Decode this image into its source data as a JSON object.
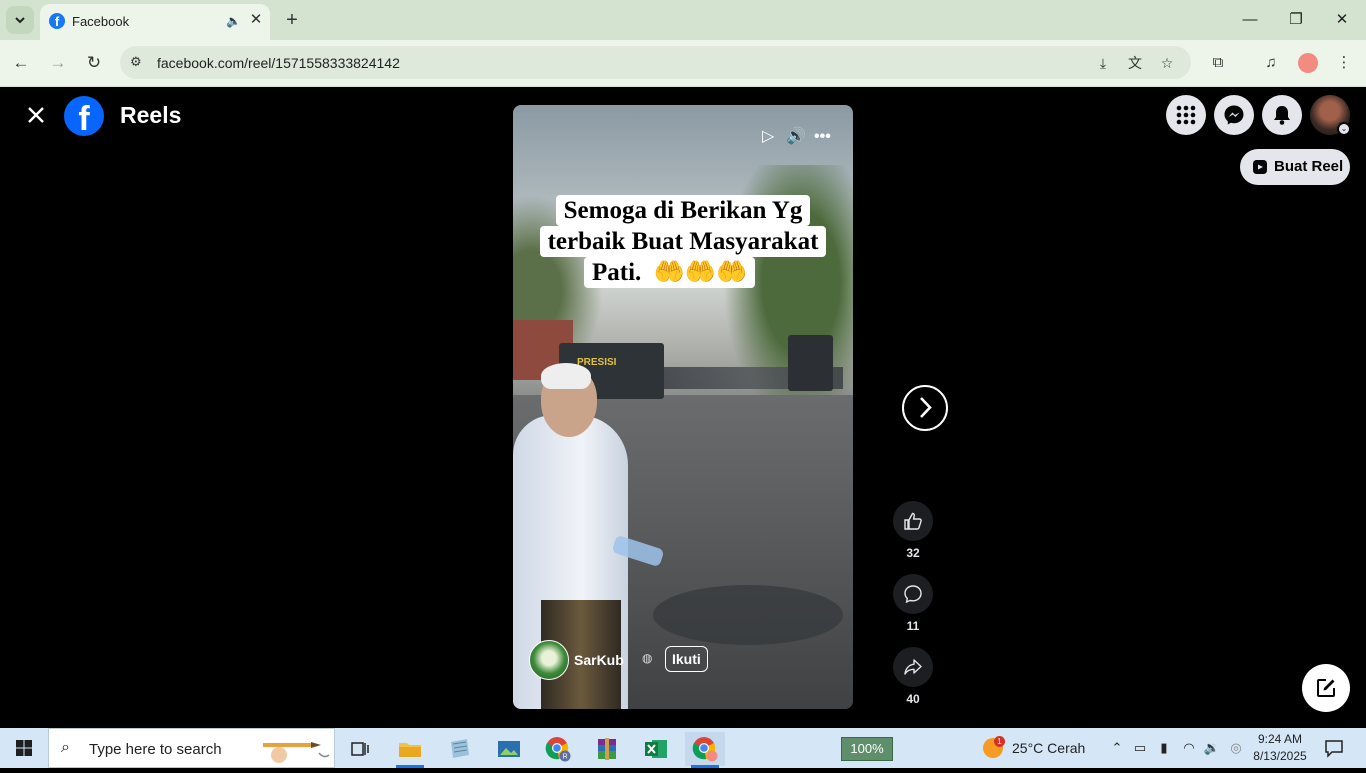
{
  "browser": {
    "tab_title": "Facebook",
    "url": "facebook.com/reel/1571558333824142"
  },
  "page": {
    "header_title": "Reels",
    "create_reel_label": "Buat Reel",
    "caption_lines": [
      "Semoga di Berikan Yg",
      "terbaik Buat Masyarakat",
      "Pati."
    ],
    "caption_emoji": "🤲🤲🤲",
    "author_name": "SarKub",
    "follow_label": "Ikuti",
    "truck_logo": "PRESISI",
    "likes": "32",
    "comments": "11",
    "shares": "40"
  },
  "taskbar": {
    "search_placeholder": "Type here to search",
    "zoom": "100%",
    "weather_badge": "1",
    "weather": "25°C  Cerah",
    "time": "9:24 AM",
    "date": "8/13/2025"
  },
  "colors": {
    "facebook_blue": "#0866ff",
    "tab_strip": "#d3e3d0",
    "toolbar": "#edf4ea",
    "taskbar": "#d5e6f7"
  }
}
